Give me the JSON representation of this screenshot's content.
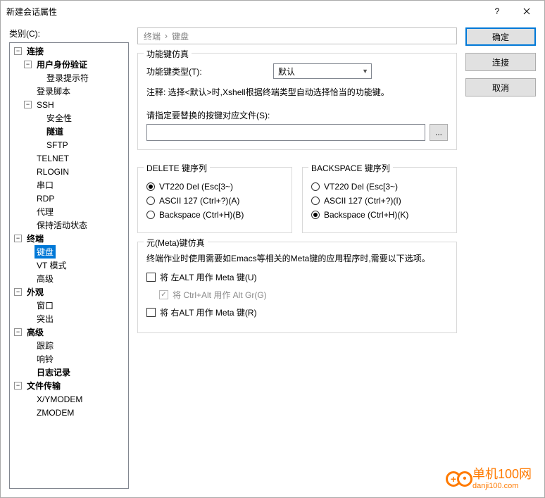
{
  "window": {
    "title": "新建会话属性"
  },
  "category_label": "类别(C):",
  "tree": {
    "lianjie": "连接",
    "yonghu": "用户身份验证",
    "denglu_tishi": "登录提示符",
    "denglu_jiaoben": "登录脚本",
    "ssh": "SSH",
    "anquan": "安全性",
    "suidao": "隧道",
    "sftp": "SFTP",
    "telnet": "TELNET",
    "rlogin": "RLOGIN",
    "chuankou": "串口",
    "rdp": "RDP",
    "daili": "代理",
    "baochi": "保持活动状态",
    "zhongduan": "终端",
    "jianpan": "键盘",
    "vtmode": "VT 模式",
    "gaoji_t": "高级",
    "waiguan": "外观",
    "chuangkou": "窗口",
    "tuchu": "突出",
    "gaoji": "高级",
    "genzong": "跟踪",
    "xiangling": "响铃",
    "rizhi": "日志记录",
    "wenjian": "文件传输",
    "xymodem": "X/YMODEM",
    "zmodem": "ZMODEM"
  },
  "breadcrumb": {
    "a": "终端",
    "b": "键盘"
  },
  "funckey": {
    "legend": "功能键仿真",
    "type_label": "功能键类型(T):",
    "type_value": "默认",
    "note": "注释: 选择<默认>时,Xshell根据终端类型自动选择恰当的功能键。",
    "file_label": "请指定要替换的按键对应文件(S):",
    "browse": "..."
  },
  "delete": {
    "legend": "DELETE 键序列",
    "opt1": "VT220 Del (Esc[3~)",
    "opt2": "ASCII 127 (Ctrl+?)(A)",
    "opt3": "Backspace (Ctrl+H)(B)"
  },
  "backspace": {
    "legend": "BACKSPACE 键序列",
    "opt1": "VT220 Del (Esc[3~)",
    "opt2": "ASCII 127 (Ctrl+?)(I)",
    "opt3": "Backspace (Ctrl+H)(K)"
  },
  "meta": {
    "legend": "元(Meta)键仿真",
    "desc": "终端作业时使用需要如Emacs等相关的Meta键的应用程序时,需要以下选项。",
    "left": "将 左ALT 用作 Meta 键(U)",
    "ctrlalt": "将 Ctrl+Alt 用作 Alt Gr(G)",
    "right": "将 右ALT 用作 Meta 键(R)"
  },
  "buttons": {
    "ok": "确定",
    "connect": "连接",
    "cancel": "取消"
  },
  "watermark": {
    "big": "单机100网",
    "small": "danji100.com"
  }
}
